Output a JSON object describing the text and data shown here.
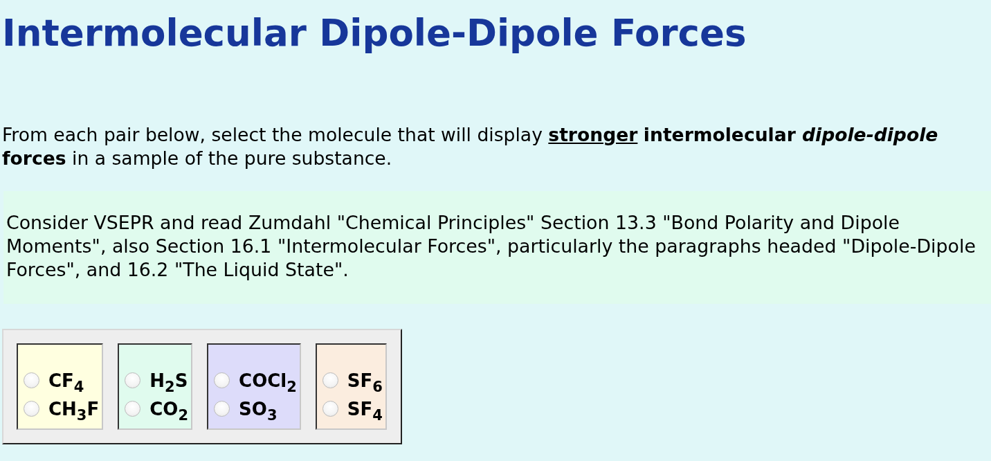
{
  "title": "Intermolecular Dipole-Dipole Forces",
  "instruction": "From each pair below, select the molecule that will display **stronger** **intermolecular *dipole-dipole* forces** in a sample of the pure substance.",
  "hint": "Consider VSEPR and read Zumdahl \"Chemical Principles\" Section 13.3 \"Bond Polarity and Dipole Moments\", also Section 16.1 \"Intermolecular Forces\", particularly the paragraphs headed \"Dipole-Dipole Forces\", and 16.2 \"The Liquid State\".",
  "pairs": [
    {
      "color": "#ffffe0",
      "options": [
        {
          "label": "CF$_{4}$",
          "selected": false
        },
        {
          "label": "CH$_{3}$F",
          "selected": false
        }
      ]
    },
    {
      "color": "#e0fbee",
      "options": [
        {
          "label": "H$_{2}$S",
          "selected": false
        },
        {
          "label": "CO$_{2}$",
          "selected": false
        }
      ]
    },
    {
      "color": "#dddcfa",
      "options": [
        {
          "label": "COCl$_{2}$",
          "selected": false
        },
        {
          "label": "SO$_{3}$",
          "selected": false
        }
      ]
    },
    {
      "color": "#fbeddf",
      "options": [
        {
          "label": "SF$_{6}$",
          "selected": false
        },
        {
          "label": "SF$_{4}$",
          "selected": false
        }
      ]
    }
  ]
}
